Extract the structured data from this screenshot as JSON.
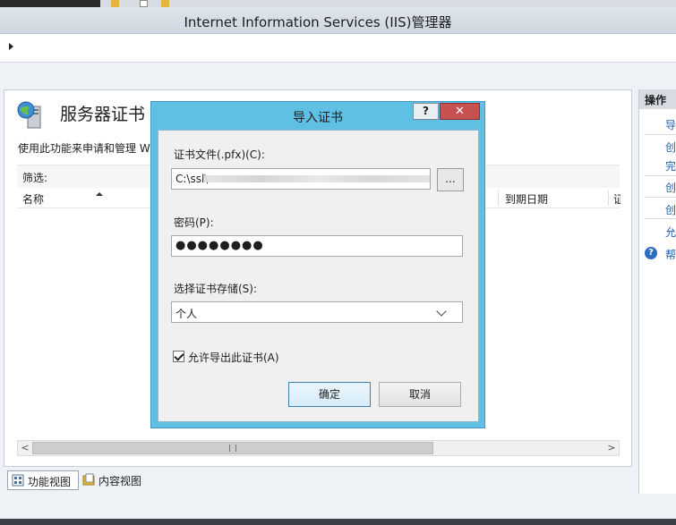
{
  "window": {
    "title": "Internet Information Services (IIS)管理器"
  },
  "main": {
    "page_title": "服务器证书",
    "description": "使用此功能来申请和管理 W",
    "filter_label": "筛选:",
    "columns": {
      "name": "名称",
      "expire": "到期日期",
      "cert": "证"
    }
  },
  "bottom_tabs": {
    "feature_view": "功能视图",
    "content_view": "内容视图"
  },
  "actions": {
    "header": "操作",
    "items": [
      "导",
      "创",
      "完",
      "创",
      "创",
      "允",
      "帮"
    ]
  },
  "dialog": {
    "title": "导入证书",
    "help_label": "?",
    "close_label": "✕",
    "file_label": "证书文件(.pfx)(C):",
    "file_value": "C:\\ssl\\",
    "browse_label": "...",
    "password_label": "密码(P):",
    "password_value": "●●●●●●●●",
    "store_label": "选择证书存储(S):",
    "store_value": "个人",
    "allow_export_label": "允许导出此证书(A)",
    "allow_export_checked": true,
    "ok_label": "确定",
    "cancel_label": "取消"
  },
  "colors": {
    "dialog_frame": "#5fc0e4",
    "close_button": "#c75050",
    "link": "#1f5fae"
  }
}
